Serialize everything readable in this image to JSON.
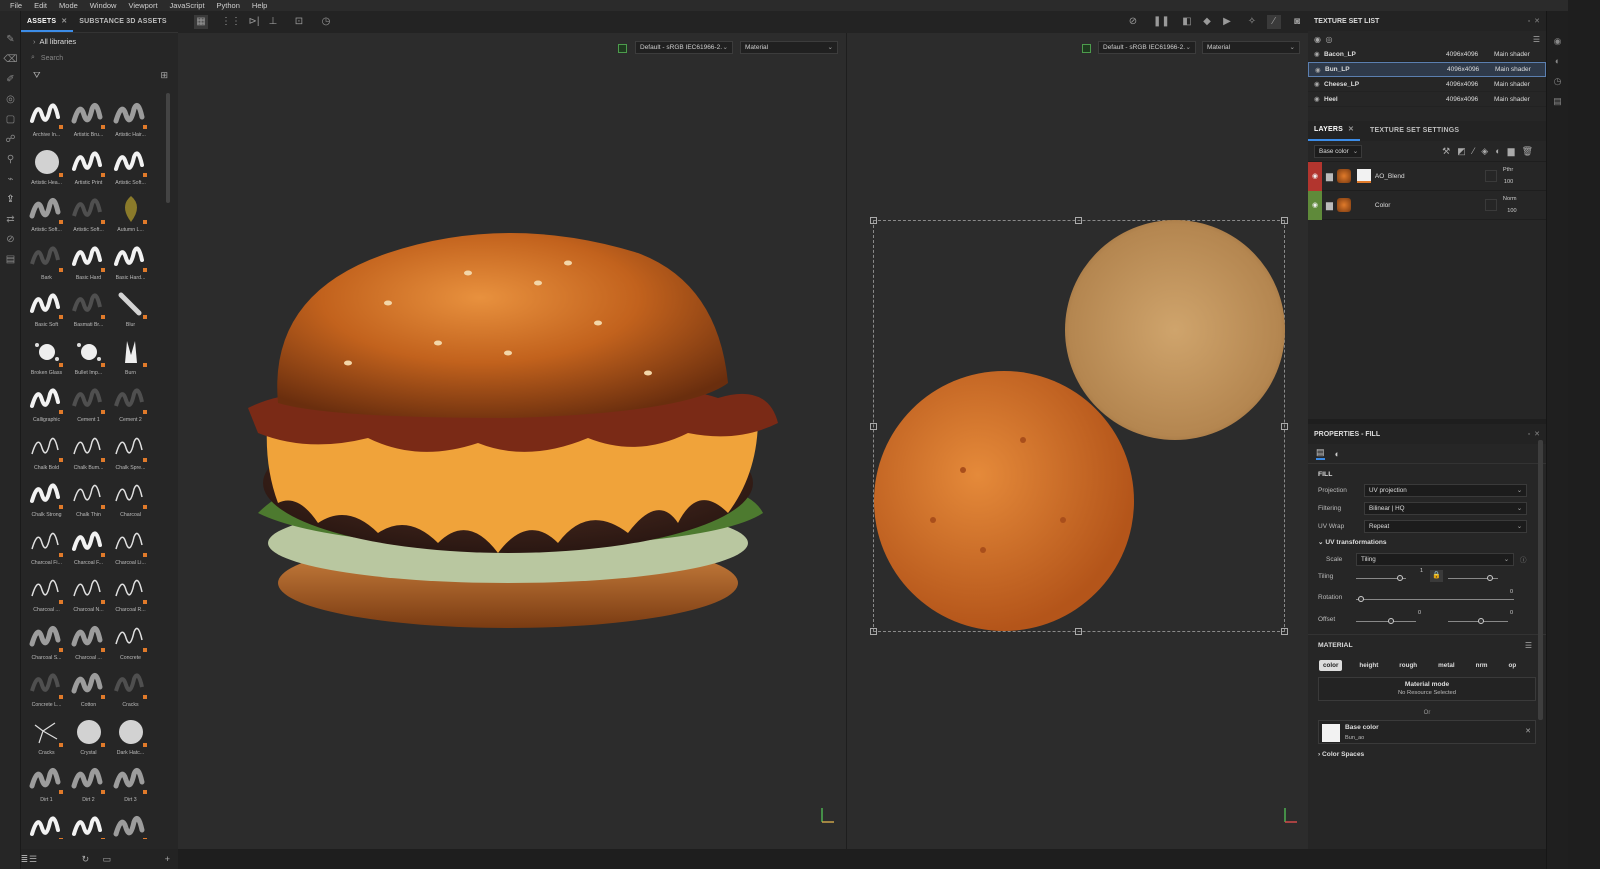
{
  "menu": [
    "File",
    "Edit",
    "Mode",
    "Window",
    "Viewport",
    "JavaScript",
    "Python",
    "Help"
  ],
  "assets": {
    "tab_assets": "ASSETS",
    "tab_substance": "SUBSTANCE 3D ASSETS",
    "library": "All libraries",
    "search_placeholder": "Search",
    "items": [
      "Archive In...",
      "Artistic Bru...",
      "Artistic Hair...",
      "Artistic Hea...",
      "Artistic Print",
      "Artistic Soft...",
      "Artistic Soft...",
      "Artistic Soft...",
      "Autumn L...",
      "Bark",
      "Basic Hard",
      "Basic Hard...",
      "Basic Soft",
      "Basmati Br...",
      "Blur",
      "Broken Glass",
      "Bullet Imp...",
      "Burn",
      "Calligraphic",
      "Cement 1",
      "Cement 2",
      "Chalk Bold",
      "Chalk Bum...",
      "Chalk Spre...",
      "Chalk Strong",
      "Chalk Thin",
      "Charcoal",
      "Charcoal Fi...",
      "Charcoal F...",
      "Charcoal Li...",
      "Charcoal ...",
      "Charcoal N...",
      "Charcoal R...",
      "Charcoal S...",
      "Charcoal ...",
      "Concrete",
      "Concrete L...",
      "Cotton",
      "Cracks",
      "Cracks",
      "Crystal",
      "Dark Hatc...",
      "Dirt 1",
      "Dirt 2",
      "Dirt 3",
      "",
      "",
      ""
    ]
  },
  "viewport": {
    "left_colorspace": "Default - sRGB IEC61966-2.",
    "left_channel": "Material",
    "right_colorspace": "Default - sRGB IEC61966-2.",
    "right_channel": "Material"
  },
  "texture_set_list": {
    "title": "TEXTURE SET LIST",
    "rows": [
      {
        "name": "Bacon_LP",
        "res": "4096x4096",
        "shader": "Main shader"
      },
      {
        "name": "Bun_LP",
        "res": "4096x4096",
        "shader": "Main shader"
      },
      {
        "name": "Cheese_LP",
        "res": "4096x4096",
        "shader": "Main shader"
      },
      {
        "name": "Heel",
        "res": "4096x4096",
        "shader": "Main shader"
      }
    ]
  },
  "layers": {
    "tab_layers": "LAYERS",
    "tab_settings": "TEXTURE SET SETTINGS",
    "channel": "Base color",
    "items": [
      {
        "name": "AO_Blend",
        "blend": "Pthr",
        "opacity": "100",
        "color": "#b2352e"
      },
      {
        "name": "Color",
        "blend": "Norm",
        "opacity": "100",
        "color": "#5f8a3a"
      }
    ]
  },
  "properties": {
    "title": "PROPERTIES - FILL",
    "section_fill": "FILL",
    "projection_label": "Projection",
    "projection_value": "UV projection",
    "filtering_label": "Filtering",
    "filtering_value": "Bilinear | HQ",
    "uvwrap_label": "UV Wrap",
    "uvwrap_value": "Repeat",
    "uvt_label": "UV transformations",
    "scale_label": "Scale",
    "scale_value": "Tiling",
    "tiling_label": "Tiling",
    "tiling_value": "1",
    "rotation_label": "Rotation",
    "rotation_value": "0",
    "offset_label": "Offset",
    "offset_x": "0",
    "offset_y": "0",
    "material_label": "MATERIAL",
    "chips": [
      "color",
      "height",
      "rough",
      "metal",
      "nrm",
      "op"
    ],
    "material_mode": "Material mode",
    "no_resource": "No Resource Selected",
    "or": "Or",
    "base_color": "Base color",
    "base_color_res": "Bun_ao",
    "color_spaces": "Color Spaces"
  }
}
